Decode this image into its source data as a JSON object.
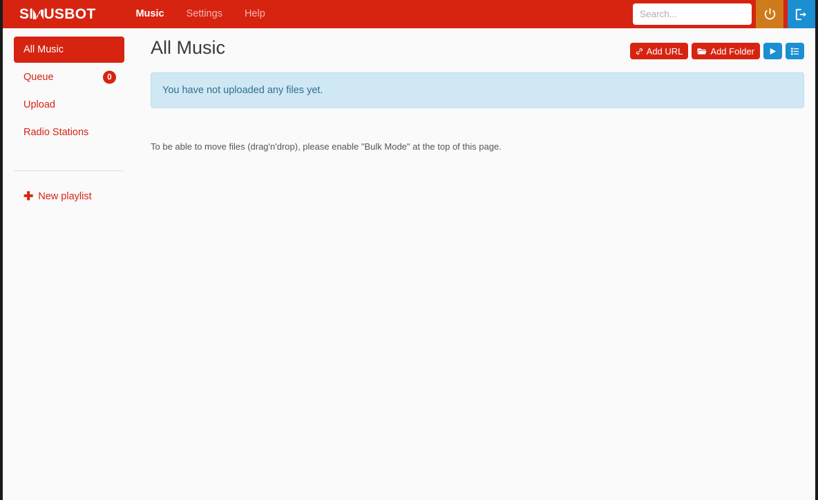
{
  "brand": {
    "text_before": "SI",
    "logo_icon": "sinusbot-n-logo",
    "text_after": "USBOT"
  },
  "nav": {
    "items": [
      {
        "label": "Music",
        "active": true
      },
      {
        "label": "Settings",
        "active": false
      },
      {
        "label": "Help",
        "active": false
      }
    ]
  },
  "search": {
    "value": "",
    "placeholder": "Search..."
  },
  "topbar_buttons": {
    "power": {
      "icon": "power-icon",
      "label": ""
    },
    "logout": {
      "icon": "logout-icon",
      "label": ""
    }
  },
  "sidebar": {
    "items": [
      {
        "label": "All Music",
        "active": true,
        "badge": null
      },
      {
        "label": "Queue",
        "active": false,
        "badge": "0"
      },
      {
        "label": "Upload",
        "active": false,
        "badge": null
      },
      {
        "label": "Radio Stations",
        "active": false,
        "badge": null
      }
    ],
    "new_playlist": {
      "label": "New playlist",
      "icon": "plus-icon"
    }
  },
  "main": {
    "title": "All Music",
    "alert_text": "You have not uploaded any files yet.",
    "hint_text": "To be able to move files (drag'n'drop), please enable \"Bulk Mode\" at the top of this page."
  },
  "toolbar": {
    "add_url_label": "Add URL",
    "add_folder_label": "Add Folder",
    "play_icon": "play-icon",
    "list_icon": "list-icon",
    "link_icon": "link-icon",
    "folder_icon": "folder-icon"
  },
  "colors": {
    "brand_red": "#d62411",
    "accent_blue": "#1b8fd1",
    "accent_orange": "#cf7a1b",
    "alert_bg": "#cfe8f3",
    "alert_text": "#31708f",
    "page_bg": "#fafafa"
  }
}
